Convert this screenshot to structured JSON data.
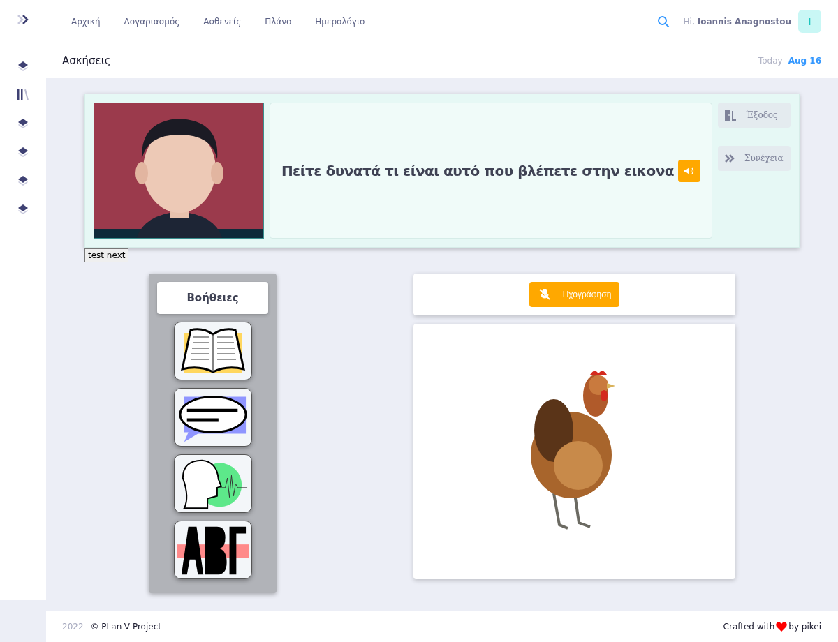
{
  "nav": {
    "items": [
      {
        "label": "Αρχική"
      },
      {
        "label": "Λογαριασμός"
      },
      {
        "label": "Ασθενείς"
      },
      {
        "label": "Πλάνο"
      },
      {
        "label": "Ημερολόγιο"
      }
    ]
  },
  "user": {
    "greeting": "Hi,",
    "name": "Ioannis Anagnostou",
    "initial": "I"
  },
  "sidebar": {
    "items": [
      {
        "kind": "layers"
      },
      {
        "kind": "library"
      },
      {
        "kind": "layers"
      },
      {
        "kind": "layers"
      },
      {
        "kind": "layers"
      },
      {
        "kind": "layers"
      }
    ]
  },
  "subheader": {
    "title": "Ασκήσεις",
    "today": "Today",
    "date": "Aug 16"
  },
  "exercise": {
    "prompt": "Πείτε δυνατά τι είναι αυτό που βλέπετε στην εικονα",
    "actions": [
      {
        "kind": "exit",
        "label": "Έξοδος"
      },
      {
        "kind": "next",
        "label": "Συνέχεια"
      }
    ]
  },
  "test_button": "test next",
  "help": {
    "title": "Βοήθειες",
    "tiles": [
      {
        "kind": "book"
      },
      {
        "kind": "bubble"
      },
      {
        "kind": "speaker"
      },
      {
        "kind": "letters"
      }
    ]
  },
  "record": {
    "label": "Ηχογράφηση",
    "muted": true
  },
  "footer": {
    "year": "2022",
    "project": "© PLan-V Project",
    "crafted": "Crafted with",
    "by": "by pikei"
  }
}
